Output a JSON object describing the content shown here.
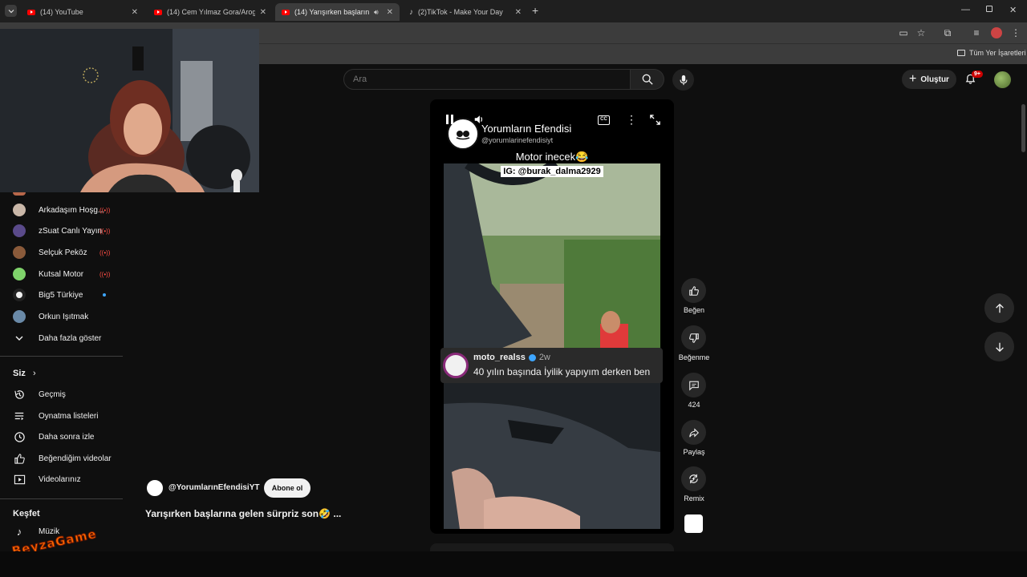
{
  "browser": {
    "tabs": [
      {
        "title": "(14) YouTube",
        "favicon": "youtube-icon"
      },
      {
        "title": "(14) Cem Yılmaz Gora/Arog Sah",
        "favicon": "youtube-icon"
      },
      {
        "title": "(14) Yarışırken başlarına gel",
        "favicon": "youtube-icon"
      },
      {
        "title": "(2)TikTok - Make Your Day",
        "favicon": "tiktok-icon"
      }
    ],
    "bookmarks_label": "Tüm Yer İşaretleri"
  },
  "header": {
    "search_placeholder": "Ara",
    "create_label": "Oluştur",
    "notification_count": "9+"
  },
  "sidebar": {
    "subscriptions": [
      {
        "label": "Arkadaşım Hoşg...",
        "live": true,
        "avatar_color": "#c9b7a8"
      },
      {
        "label": "zSuat Canlı Yayın",
        "live": true,
        "avatar_color": "#5a4a8a"
      },
      {
        "label": "Selçuk Peköz",
        "live": true,
        "avatar_color": "#8a5a3a"
      },
      {
        "label": "Kutsal Motor",
        "live": true,
        "avatar_color": "#7fd36b"
      },
      {
        "label": "Big5 Türkiye",
        "live": false,
        "new": true,
        "avatar_color": "#f1f1f1"
      },
      {
        "label": "Orkun Işıtmak",
        "live": false,
        "avatar_color": "#6a8aa8"
      }
    ],
    "show_more": "Daha fazla göster",
    "you_title": "Siz",
    "you_items": [
      {
        "label": "Geçmiş",
        "icon": "history-icon"
      },
      {
        "label": "Oynatma listeleri",
        "icon": "playlist-icon"
      },
      {
        "label": "Daha sonra izle",
        "icon": "clock-icon"
      },
      {
        "label": "Beğendiğim videolar",
        "icon": "thumb-up-icon"
      },
      {
        "label": "Videolarınız",
        "icon": "video-icon"
      }
    ],
    "explore_title": "Keşfet",
    "explore_items": [
      {
        "label": "Müzik",
        "icon": "music-note-icon"
      }
    ]
  },
  "short": {
    "channel_name": "Yorumların Efendisi",
    "channel_handle": "@yorumlarinefendisiyt",
    "caption_line1": "Motor inecek😂",
    "caption_line2": "IG: @burak_dalma2929",
    "comment_user": "moto_realss",
    "comment_time": "2w",
    "comment_text": "40 yılın başında İyilik yapıyım derken ben",
    "uploader": "@YorumlarınEfendisiYT",
    "subscribe_label": "Abone ol",
    "title": "Yarışırken başlarına gelen sürpriz son🤣 ..."
  },
  "actions": {
    "like_label": "Beğen",
    "dislike_label": "Beğenme",
    "comments_count": "424",
    "share_label": "Paylaş",
    "remix_label": "Remix"
  },
  "colors": {
    "live_red": "#ff4e45",
    "youtube_red": "#ff0000",
    "accent_blue": "#3ea6ff"
  },
  "overlay_text": "BeyzaGame"
}
